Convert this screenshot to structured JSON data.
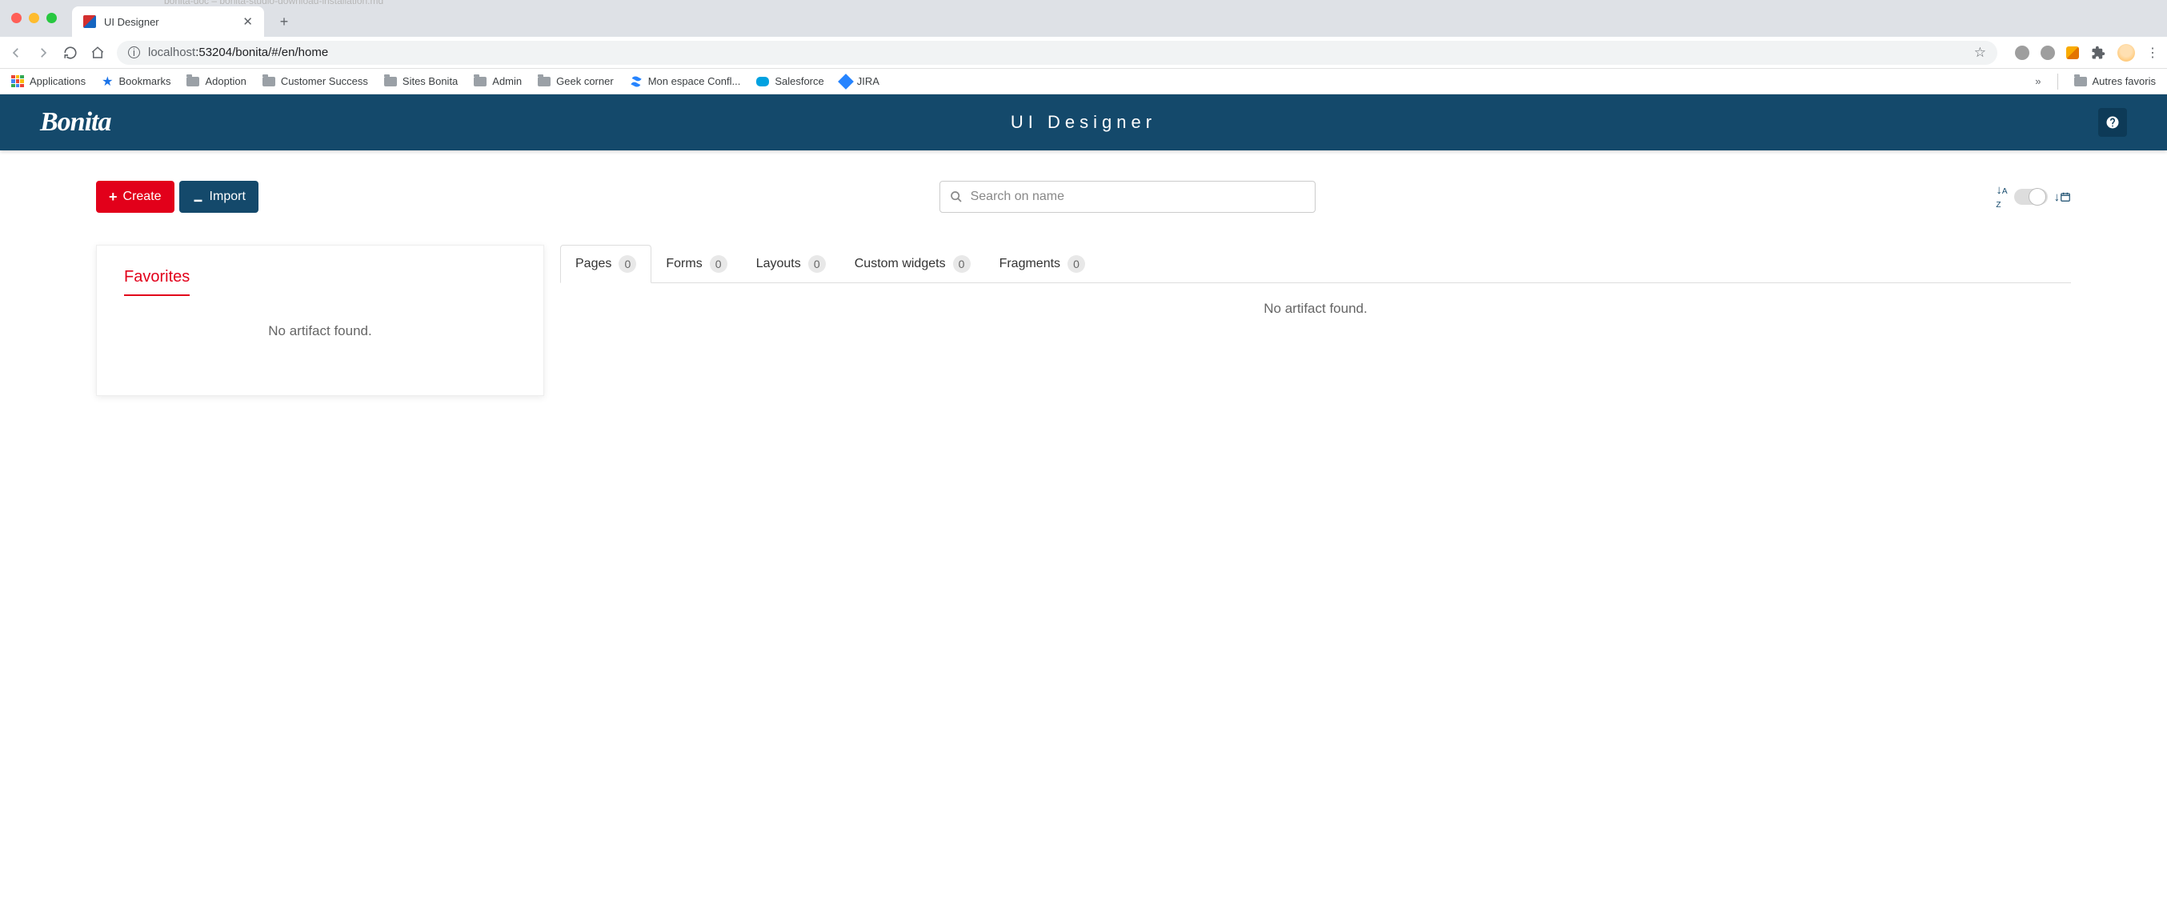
{
  "browser": {
    "hidden_tab_text": "bonita-doc – bonita-studio-download-installation.md",
    "tab_title": "UI Designer",
    "url_host": "localhost",
    "url_path": ":53204/bonita/#/en/home",
    "bookmarks": {
      "apps": "Applications",
      "bookmarks": "Bookmarks",
      "adoption": "Adoption",
      "customer_success": "Customer Success",
      "sites_bonita": "Sites Bonita",
      "admin": "Admin",
      "geek_corner": "Geek corner",
      "confluence": "Mon espace Confl...",
      "salesforce": "Salesforce",
      "jira": "JIRA",
      "other": "Autres favoris"
    }
  },
  "header": {
    "logo": "Bonita",
    "title": "UI Designer"
  },
  "actions": {
    "create": "Create",
    "import": "Import"
  },
  "search": {
    "placeholder": "Search on name"
  },
  "favorites": {
    "title": "Favorites",
    "empty": "No artifact found."
  },
  "tabs": [
    {
      "label": "Pages",
      "count": 0
    },
    {
      "label": "Forms",
      "count": 0
    },
    {
      "label": "Layouts",
      "count": 0
    },
    {
      "label": "Custom widgets",
      "count": 0
    },
    {
      "label": "Fragments",
      "count": 0
    }
  ],
  "tab_content": {
    "empty": "No artifact found."
  }
}
